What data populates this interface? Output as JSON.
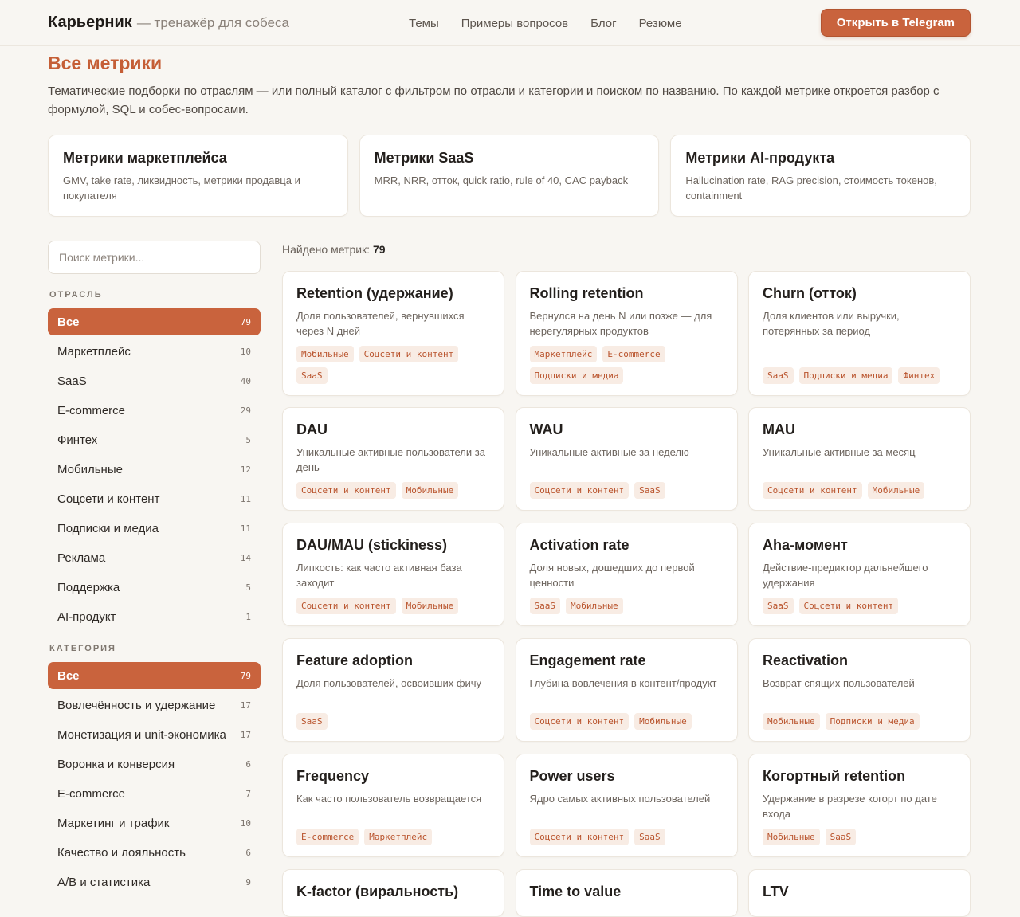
{
  "header": {
    "brand": "Карьерник",
    "tagline": "— тренажёр для собеса",
    "nav": [
      "Темы",
      "Примеры вопросов",
      "Блог",
      "Резюме"
    ],
    "cta": "Открыть в Telegram"
  },
  "page": {
    "title": "Все метрики",
    "intro": "Тематические подборки по отраслям — или полный каталог с фильтром по отрасли и категории и поиском по названию. По каждой метрике откроется разбор с формулой, SQL и собес-вопросами."
  },
  "themes": [
    {
      "title": "Метрики маркетплейса",
      "desc": "GMV, take rate, ликвидность, метрики продавца и покупателя"
    },
    {
      "title": "Метрики SaaS",
      "desc": "MRR, NRR, отток, quick ratio, rule of 40, CAC payback"
    },
    {
      "title": "Метрики AI-продукта",
      "desc": "Hallucination rate, RAG precision, стоимость токенов, containment"
    }
  ],
  "sidebar": {
    "search_placeholder": "Поиск метрики...",
    "industry_heading": "ОТРАСЛЬ",
    "industries": [
      {
        "label": "Все",
        "count": "79",
        "active": true
      },
      {
        "label": "Маркетплейс",
        "count": "10"
      },
      {
        "label": "SaaS",
        "count": "40"
      },
      {
        "label": "E-commerce",
        "count": "29"
      },
      {
        "label": "Финтех",
        "count": "5"
      },
      {
        "label": "Мобильные",
        "count": "12"
      },
      {
        "label": "Соцсети и контент",
        "count": "11"
      },
      {
        "label": "Подписки и медиа",
        "count": "11"
      },
      {
        "label": "Реклама",
        "count": "14"
      },
      {
        "label": "Поддержка",
        "count": "5"
      },
      {
        "label": "AI-продукт",
        "count": "1"
      }
    ],
    "category_heading": "КАТЕГОРИЯ",
    "categories": [
      {
        "label": "Все",
        "count": "79",
        "active": true
      },
      {
        "label": "Вовлечённость и удержание",
        "count": "17"
      },
      {
        "label": "Монетизация и unit-экономика",
        "count": "17"
      },
      {
        "label": "Воронка и конверсия",
        "count": "6"
      },
      {
        "label": "E-commerce",
        "count": "7"
      },
      {
        "label": "Маркетинг и трафик",
        "count": "10"
      },
      {
        "label": "Качество и лояльность",
        "count": "6"
      },
      {
        "label": "A/B и статистика",
        "count": "9"
      }
    ]
  },
  "results": {
    "found_label": "Найдено метрик:",
    "found_count": "79"
  },
  "metrics": [
    {
      "title": "Retention (удержание)",
      "desc": "Доля пользователей, вернувшихся через N дней",
      "tags": [
        "Мобильные",
        "Соцсети и контент",
        "SaaS"
      ]
    },
    {
      "title": "Rolling retention",
      "desc": "Вернулся на день N или позже — для нерегулярных продуктов",
      "tags": [
        "Маркетплейс",
        "E-commerce",
        "Подписки и медиа"
      ]
    },
    {
      "title": "Churn (отток)",
      "desc": "Доля клиентов или выручки, потерянных за период",
      "tags": [
        "SaaS",
        "Подписки и медиа",
        "Финтех"
      ]
    },
    {
      "title": "DAU",
      "desc": "Уникальные активные пользователи за день",
      "tags": [
        "Соцсети и контент",
        "Мобильные"
      ]
    },
    {
      "title": "WAU",
      "desc": "Уникальные активные за неделю",
      "tags": [
        "Соцсети и контент",
        "SaaS"
      ]
    },
    {
      "title": "MAU",
      "desc": "Уникальные активные за месяц",
      "tags": [
        "Соцсети и контент",
        "Мобильные"
      ]
    },
    {
      "title": "DAU/MAU (stickiness)",
      "desc": "Липкость: как часто активная база заходит",
      "tags": [
        "Соцсети и контент",
        "Мобильные"
      ]
    },
    {
      "title": "Activation rate",
      "desc": "Доля новых, дошедших до первой ценности",
      "tags": [
        "SaaS",
        "Мобильные"
      ]
    },
    {
      "title": "Aha-момент",
      "desc": "Действие-предиктор дальнейшего удержания",
      "tags": [
        "SaaS",
        "Соцсети и контент"
      ]
    },
    {
      "title": "Feature adoption",
      "desc": "Доля пользователей, освоивших фичу",
      "tags": [
        "SaaS"
      ]
    },
    {
      "title": "Engagement rate",
      "desc": "Глубина вовлечения в контент/продукт",
      "tags": [
        "Соцсети и контент",
        "Мобильные"
      ]
    },
    {
      "title": "Reactivation",
      "desc": "Возврат спящих пользователей",
      "tags": [
        "Мобильные",
        "Подписки и медиа"
      ]
    },
    {
      "title": "Frequency",
      "desc": "Как часто пользователь возвращается",
      "tags": [
        "E-commerce",
        "Маркетплейс"
      ]
    },
    {
      "title": "Power users",
      "desc": "Ядро самых активных пользователей",
      "tags": [
        "Соцсети и контент",
        "SaaS"
      ]
    },
    {
      "title": "Когортный retention",
      "desc": "Удержание в разрезе когорт по дате входа",
      "tags": [
        "Мобильные",
        "SaaS"
      ]
    },
    {
      "title": "K-factor (виральность)",
      "desc": "",
      "tags": []
    },
    {
      "title": "Time to value",
      "desc": "",
      "tags": []
    },
    {
      "title": "LTV",
      "desc": "",
      "tags": []
    }
  ]
}
